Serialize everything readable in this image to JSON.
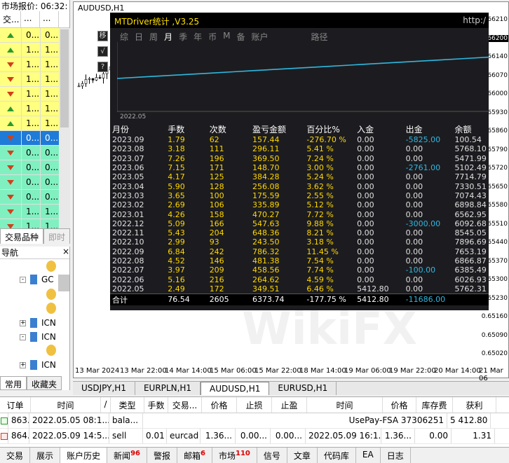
{
  "market_watch": {
    "title": "市场报价: 06:32:",
    "headers": [
      "交...",
      "...",
      "..."
    ],
    "rows": [
      {
        "dir": "up",
        "v1": "0...",
        "v2": "0...",
        "color": "#ffff80"
      },
      {
        "dir": "up",
        "v1": "1...",
        "v2": "1...",
        "color": "#ffff80"
      },
      {
        "dir": "dn",
        "v1": "1...",
        "v2": "1...",
        "color": "#ffff80"
      },
      {
        "dir": "dn",
        "v1": "1...",
        "v2": "1...",
        "color": "#ffff80"
      },
      {
        "dir": "dn",
        "v1": "1...",
        "v2": "1...",
        "color": "#ffff80"
      },
      {
        "dir": "up",
        "v1": "1...",
        "v2": "1...",
        "color": "#ffff80"
      },
      {
        "dir": "up",
        "v1": "1...",
        "v2": "1...",
        "color": "#ffff80"
      },
      {
        "dir": "dn",
        "v1": "0...",
        "v2": "0...",
        "color": "#1e7bd8"
      },
      {
        "dir": "dn",
        "v1": "0...",
        "v2": "0...",
        "color": "#80f0c0"
      },
      {
        "dir": "dn",
        "v1": "0...",
        "v2": "0...",
        "color": "#80f0c0"
      },
      {
        "dir": "dn",
        "v1": "0...",
        "v2": "0...",
        "color": "#80f0c0"
      },
      {
        "dir": "dn",
        "v1": "0...",
        "v2": "0...",
        "color": "#80f0c0"
      },
      {
        "dir": "dn",
        "v1": "1...",
        "v2": "1...",
        "color": "#80f0c0"
      },
      {
        "dir": "dn",
        "v1": "1...",
        "v2": "1...",
        "color": "#80f0c0"
      }
    ],
    "tabs": [
      "交易品种",
      "即时"
    ]
  },
  "navigator": {
    "title": "导航",
    "items": [
      "GC",
      "ICN",
      "ICN",
      "ICN"
    ],
    "tabs": [
      "常用",
      "收藏夹"
    ]
  },
  "chart": {
    "title": "AUDUSD,H1",
    "yticks": [
      {
        "v": "0.66210",
        "hl": false
      },
      {
        "v": "0.66200",
        "hl": true
      },
      {
        "v": "0.66140",
        "hl": false
      },
      {
        "v": "0.66070",
        "hl": false
      },
      {
        "v": "0.66000",
        "hl": false
      },
      {
        "v": "0.65930",
        "hl": false
      },
      {
        "v": "0.65860",
        "hl": false
      },
      {
        "v": "0.65790",
        "hl": false
      },
      {
        "v": "0.65720",
        "hl": false
      },
      {
        "v": "0.65650",
        "hl": false
      },
      {
        "v": "0.65580",
        "hl": false
      },
      {
        "v": "0.65510",
        "hl": false
      },
      {
        "v": "0.65440",
        "hl": false
      },
      {
        "v": "0.65370",
        "hl": false
      },
      {
        "v": "0.65300",
        "hl": false
      },
      {
        "v": "0.65230",
        "hl": false
      },
      {
        "v": "0.65160",
        "hl": false
      },
      {
        "v": "0.65090",
        "hl": false
      },
      {
        "v": "0.65020",
        "hl": false
      }
    ],
    "xticks": [
      "13 Mar 2024",
      "13 Mar 22:00",
      "14 Mar 14:00",
      "15 Mar 06:00",
      "15 Mar 22:00",
      "18 Mar 14:00",
      "19 Mar 06:00",
      "19 Mar 22:00",
      "20 Mar 14:00",
      "21 Mar 06"
    ]
  },
  "stats": {
    "title": "MTDriver统计 ,V3.25",
    "url": "http:/",
    "toolbar": [
      "综",
      "日",
      "周",
      "月",
      "季",
      "年",
      "币",
      "M",
      "备",
      "账户",
      "路径"
    ],
    "active": "月",
    "side_buttons": [
      "移",
      "√",
      "?"
    ],
    "chart_start": "2022.05",
    "headers": [
      "月份",
      "手数",
      "次数",
      "盈亏金额",
      "百分比%",
      "入金",
      "出金",
      "余额"
    ],
    "rows": [
      [
        "2023.09",
        "1.79",
        "62",
        "157.44",
        "-276.70 %",
        "0.00",
        "-5825.00",
        "100.54"
      ],
      [
        "2023.08",
        "3.18",
        "111",
        "296.11",
        "5.41 %",
        "0.00",
        "0.00",
        "5768.10"
      ],
      [
        "2023.07",
        "7.26",
        "196",
        "369.50",
        "7.24 %",
        "0.00",
        "0.00",
        "5471.99"
      ],
      [
        "2023.06",
        "7.15",
        "171",
        "148.70",
        "3.00 %",
        "0.00",
        "-2761.00",
        "5102.49"
      ],
      [
        "2023.05",
        "4.17",
        "125",
        "384.28",
        "5.24 %",
        "0.00",
        "0.00",
        "7714.79"
      ],
      [
        "2023.04",
        "5.90",
        "128",
        "256.08",
        "3.62 %",
        "0.00",
        "0.00",
        "7330.51"
      ],
      [
        "2023.03",
        "3.65",
        "100",
        "175.59",
        "2.55 %",
        "0.00",
        "0.00",
        "7074.43"
      ],
      [
        "2023.02",
        "2.69",
        "106",
        "335.89",
        "5.12 %",
        "0.00",
        "0.00",
        "6898.84"
      ],
      [
        "2023.01",
        "4.26",
        "158",
        "470.27",
        "7.72 %",
        "0.00",
        "0.00",
        "6562.95"
      ],
      [
        "2022.12",
        "5.09",
        "166",
        "547.63",
        "9.88 %",
        "0.00",
        "-3000.00",
        "6092.68"
      ],
      [
        "2022.11",
        "5.43",
        "204",
        "648.36",
        "8.21 %",
        "0.00",
        "0.00",
        "8545.05"
      ],
      [
        "2022.10",
        "2.99",
        "93",
        "243.50",
        "3.18 %",
        "0.00",
        "0.00",
        "7896.69"
      ],
      [
        "2022.09",
        "6.84",
        "242",
        "786.32",
        "11.45 %",
        "0.00",
        "0.00",
        "7653.19"
      ],
      [
        "2022.08",
        "4.52",
        "146",
        "481.38",
        "7.54 %",
        "0.00",
        "0.00",
        "6866.87"
      ],
      [
        "2022.07",
        "3.97",
        "209",
        "458.56",
        "7.74 %",
        "0.00",
        "-100.00",
        "6385.49"
      ],
      [
        "2022.06",
        "5.16",
        "216",
        "264.62",
        "4.59 %",
        "0.00",
        "0.00",
        "6026.93"
      ],
      [
        "2022.05",
        "2.49",
        "172",
        "349.51",
        "6.46 %",
        "5412.80",
        "0.00",
        "5762.31"
      ]
    ],
    "total": [
      "合计",
      "76.54",
      "2605",
      "6373.74",
      "-177.75 %",
      "5412.80",
      "-11686.00",
      ""
    ],
    "watermark": "WikiFX"
  },
  "chart_tabs": [
    "USDJPY,H1",
    "EURPLN,H1",
    "AUDUSD,H1",
    "EURUSD,H1"
  ],
  "chart_tab_active": "AUDUSD,H1",
  "terminal": {
    "headers": [
      "订单",
      "时间",
      "/",
      "类型",
      "手数",
      "交易...",
      "价格",
      "止损",
      "止盈",
      "时间",
      "价格",
      "库存费",
      "获利"
    ],
    "rows": [
      [
        "863...",
        "2022.05.05 08:1...",
        "bala...",
        "",
        "",
        "",
        "",
        "",
        "",
        "UsePay-FSA 37306251",
        "",
        "",
        "5 412.80"
      ],
      [
        "864...",
        "2022.05.09 14:5...",
        "sell",
        "0.01",
        "eurcad",
        "1.36...",
        "0.00...",
        "0.00...",
        "2022.05.09 16:1...",
        "1.36...",
        "0.00",
        "1.31"
      ]
    ]
  },
  "bottom_tabs": [
    {
      "l": "交易",
      "b": ""
    },
    {
      "l": "展示",
      "b": ""
    },
    {
      "l": "账户历史",
      "b": ""
    },
    {
      "l": "新闻",
      "b": "96"
    },
    {
      "l": "警报",
      "b": ""
    },
    {
      "l": "邮箱",
      "b": "6"
    },
    {
      "l": "市场",
      "b": "110"
    },
    {
      "l": "信号",
      "b": ""
    },
    {
      "l": "文章",
      "b": ""
    },
    {
      "l": "代码库",
      "b": ""
    },
    {
      "l": "EA",
      "b": ""
    },
    {
      "l": "日志",
      "b": ""
    }
  ],
  "bottom_tab_active": "账户历史"
}
